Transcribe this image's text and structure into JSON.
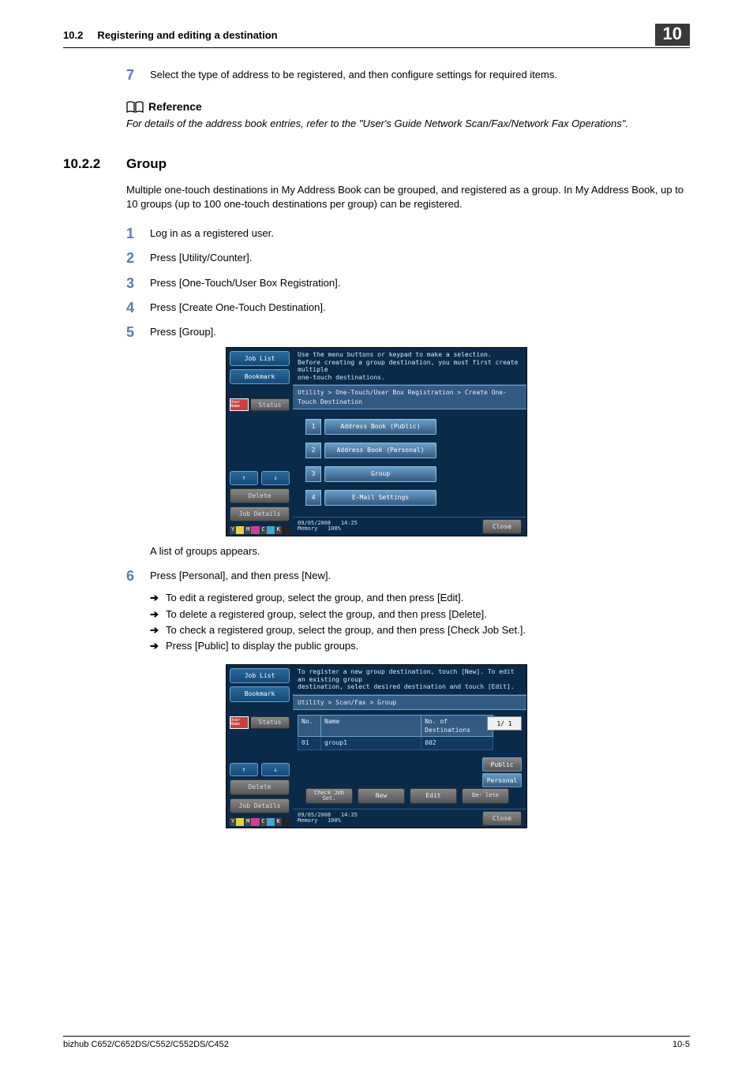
{
  "header": {
    "section_num": "10.2",
    "section_title": "Registering and editing a destination",
    "chapter_tab": "10"
  },
  "step7": {
    "num": "7",
    "text": "Select the type of address to be registered, and then configure settings for required items."
  },
  "reference": {
    "label": "Reference",
    "body": "For details of the address book entries, refer to the \"User's Guide Network Scan/Fax/Network Fax Operations\"."
  },
  "section": {
    "num": "10.2.2",
    "title": "Group",
    "intro": "Multiple one-touch destinations in My Address Book can be grouped, and registered as a group. In My Address Book, up to 10 groups (up to 100 one-touch destinations per group) can be registered."
  },
  "steps": [
    {
      "num": "1",
      "text": "Log in as a registered user."
    },
    {
      "num": "2",
      "text": "Press [Utility/Counter]."
    },
    {
      "num": "3",
      "text": "Press [One-Touch/User Box Registration]."
    },
    {
      "num": "4",
      "text": "Press [Create One-Touch Destination]."
    },
    {
      "num": "5",
      "text": "Press [Group]."
    }
  ],
  "after5": "A list of groups appears.",
  "step6": {
    "num": "6",
    "text": "Press [Personal], and then press [New].",
    "subs": [
      "To edit a registered group, select the group, and then press [Edit].",
      "To delete a registered group, select the group, and then press [Delete].",
      "To check a registered group, select the group, and then press [Check Job Set.].",
      "Press [Public] to display the public groups."
    ]
  },
  "shot_common_left": {
    "job_list": "Job List",
    "bookmark": "Bookmark",
    "user_name": "User Name",
    "status": "Status",
    "delete": "Delete",
    "job_details": "Job Details",
    "ymck": [
      "Y",
      "M",
      "C",
      "K"
    ]
  },
  "shot1": {
    "msg": "Use the menu buttons or keypad to make a selection.\nBefore creating a group destination, you must first create multiple\none-touch destinations.",
    "breadcrumb": "Utility > One-Touch/User Box Registration > Create One-Touch Destination",
    "items": [
      {
        "n": "1",
        "label": "Address Book (Public)"
      },
      {
        "n": "2",
        "label": "Address Book (Personal)"
      },
      {
        "n": "3",
        "label": "Group"
      },
      {
        "n": "4",
        "label": "E-Mail Settings"
      }
    ],
    "date": "09/05/2008",
    "time": "14:25",
    "memory": "Memory",
    "mempct": "100%",
    "close": "Close"
  },
  "shot2": {
    "msg": "To register a new group destination, touch [New]. To edit an existing group\ndestination, select desired destination and touch [Edit].",
    "breadcrumb": "Utility > Scan/Fax > Group",
    "cols": {
      "no": "No.",
      "name": "Name",
      "dest": "No. of Destinations"
    },
    "row": {
      "no": "01",
      "name": "group1",
      "dest": "002"
    },
    "page": "1/  1",
    "public": "Public",
    "personal": "Personal",
    "btns": {
      "check": "Check Job Set.",
      "new": "New",
      "edit": "Edit",
      "del": "De- lete"
    },
    "date": "09/05/2008",
    "time": "14:25",
    "memory": "Memory",
    "mempct": "100%",
    "close": "Close"
  },
  "footer": {
    "left": "bizhub C652/C652DS/C552/C552DS/C452",
    "right": "10-5"
  }
}
